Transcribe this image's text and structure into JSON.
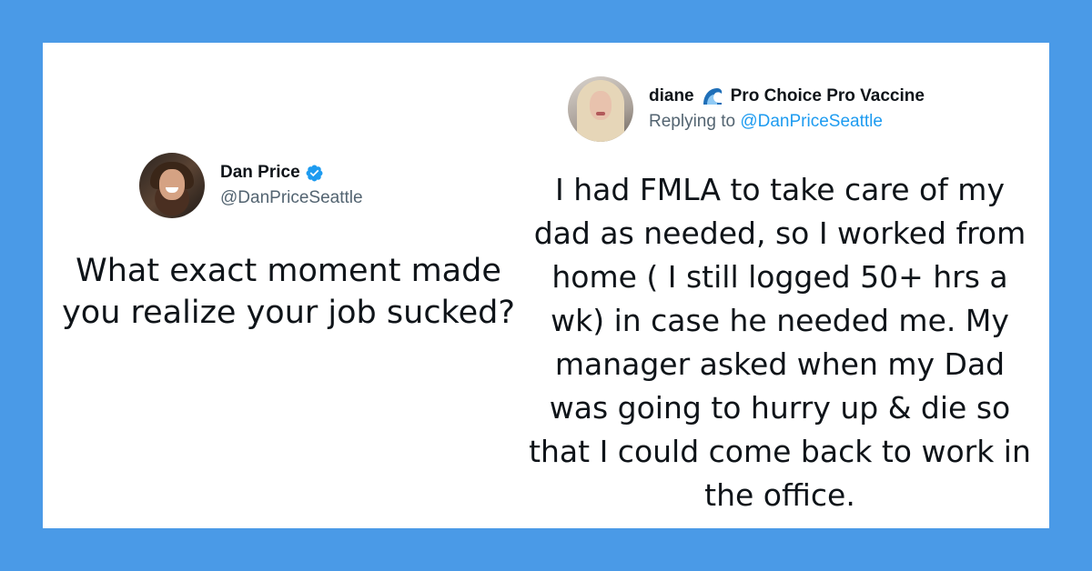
{
  "colors": {
    "frame_background": "#4a9ae7",
    "card_background": "#ffffff",
    "text_primary": "#0f1419",
    "text_secondary": "#536471",
    "link": "#1d9bf0",
    "verified_badge": "#1d9bf0"
  },
  "original_tweet": {
    "author": {
      "display_name": "Dan Price",
      "handle": "@DanPriceSeattle",
      "verified": true,
      "avatar_icon": "avatar-photo",
      "badge_icon": "verified-badge-icon"
    },
    "text": "What exact moment made you realize your job sucked?"
  },
  "reply_tweet": {
    "author": {
      "display_name": "diane",
      "name_emoji_icon": "wave-emoji-icon",
      "name_suffix": "Pro Choice Pro Vaccine",
      "avatar_icon": "avatar-photo"
    },
    "replying_label": "Replying to",
    "replying_handle": "@DanPriceSeattle",
    "text": "I had FMLA to take care of my dad as needed, so I worked from home ( I still logged 50+ hrs a wk) in case he needed me. My manager asked when my Dad was going to hurry up & die so that I could come back to work in the office."
  }
}
